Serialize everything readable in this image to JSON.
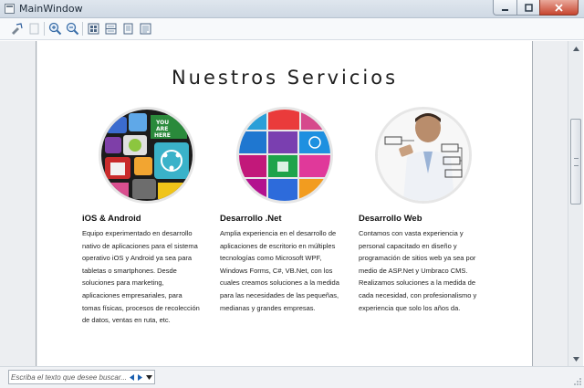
{
  "window": {
    "title": "MainWindow"
  },
  "toolbar": {
    "buttons": [
      "copy-icon",
      "paste-icon",
      "zoom-in-icon",
      "zoom-out-icon",
      "view-full-page-icon",
      "view-two-pages-icon",
      "view-single-page-icon",
      "view-document-icon"
    ]
  },
  "page": {
    "title": "Nuestros Servicios",
    "services": [
      {
        "heading": "iOS & Android",
        "lines": [
          "Equipo experimentado en desarrollo",
          "nativo de aplicaciones para el sistema",
          "operativo iOS y Android ya sea para",
          "tabletas o smartphones. Desde",
          "soluciones para marketing,",
          "aplicaciones empresariales, para",
          "tomas físicas, procesos de recolección",
          "de datos, ventas en ruta, etc."
        ]
      },
      {
        "heading": "Desarrollo .Net",
        "lines": [
          "Amplia experiencia en el desarrollo de",
          "aplicaciones de escritorio en múltiples",
          "tecnologías como Microsoft WPF,",
          "Windows Forms, C#, VB.Net, con los",
          "cuales creamos soluciones a la medida",
          "para las necesidades de las pequeñas,",
          "medianas y grandes empresas."
        ]
      },
      {
        "heading": "Desarrollo Web",
        "lines": [
          "Contamos con vasta experiencia y",
          "personal capacitado en diseño y",
          "programación de sitios web ya sea por",
          "medio de ASP.Net y Umbraco CMS.",
          "Realizamos soluciones a la medida de",
          "cada necesidad, con profesionalismo y",
          "experiencia que solo los años da."
        ]
      }
    ]
  },
  "search": {
    "placeholder": "Escriba el texto que desee buscar..."
  },
  "colors": {
    "accent": "#1a5fb0",
    "close_button": "#c7452f"
  }
}
